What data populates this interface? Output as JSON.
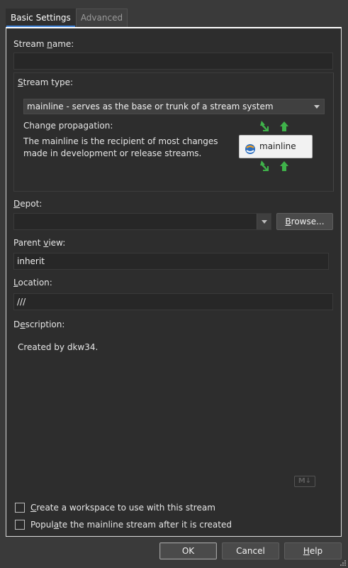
{
  "tabs": [
    {
      "label": "Basic Settings",
      "active": true
    },
    {
      "label": "Advanced",
      "active": false
    }
  ],
  "stream_name": {
    "label_pre": "Stream ",
    "label_u": "n",
    "label_post": "ame:",
    "value": ""
  },
  "stream_type": {
    "label_u": "S",
    "label_post": "tream type:",
    "selected": "mainline - serves as the base or trunk of a stream system",
    "propagation_label": "Change propagation:",
    "propagation_desc": "The mainline is the recipient of most changes made in development or release streams.",
    "card_label": "mainline",
    "arrow_color_green": "#3fb24a"
  },
  "depot": {
    "label_u": "D",
    "label_post": "epot:",
    "value": "",
    "browse_u": "B",
    "browse_post": "rowse..."
  },
  "parent_view": {
    "label_pre": "Parent ",
    "label_u": "v",
    "label_post": "iew:",
    "value": "inherit"
  },
  "location": {
    "label_u": "L",
    "label_post": "ocation:",
    "value": "///"
  },
  "description": {
    "label_pre": "D",
    "label_u": "e",
    "label_post": "scription:",
    "value": "Created by dkw34.",
    "markdown_icon": "M↓"
  },
  "options": [
    {
      "label_u": "C",
      "label_post": "reate a workspace to use with this stream",
      "checked": false
    },
    {
      "label_pre": "Popul",
      "label_u": "a",
      "label_post": "te the mainline stream after it is created",
      "checked": false
    }
  ],
  "buttons": {
    "ok": "OK",
    "cancel": "Cancel",
    "help_u": "H",
    "help_post": "elp"
  },
  "colors": {
    "tab_accent": "#3b7fd6",
    "panel_bg": "#2d2d2d",
    "window_bg": "#3a3a3a"
  }
}
